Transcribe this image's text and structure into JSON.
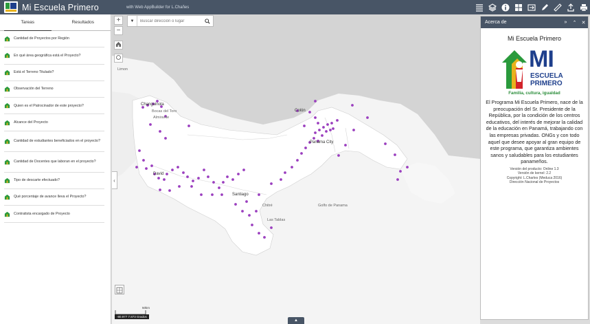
{
  "header": {
    "title": "Mi Escuela Primero",
    "subtitle": "with Web AppBuilder for L.Chañes",
    "tools": [
      "list-icon",
      "layers-icon",
      "info-icon",
      "basemap-icon",
      "swipe-icon",
      "draw-icon",
      "measure-icon",
      "share-icon",
      "print-icon"
    ]
  },
  "left_panel": {
    "tabs": [
      "Tareas",
      "Resultados"
    ],
    "tasks": [
      "Cantidad de Proyectos por Región",
      "En qué área geográfica está el Proyecto?",
      "Está el Terreno Titulado?",
      "Observación del Terreno",
      "Quien es el Patrocinador de este proyecto?",
      "Alcance del Proyecto",
      "Cantidad de estudiantes beneficiados en el proyecto?",
      "Cantidad de Docentes que laboran en el proyecto?",
      "Tipo de descarte efectuado?",
      "Qué porcentaje de avance lleva el Proyecto?",
      "Contratista encargado de Proyecto"
    ]
  },
  "map": {
    "search_placeholder": "Buscar dirección o lugar",
    "zoom_in": "+",
    "zoom_out": "−",
    "scale_label": "50km",
    "coordinates": "-80.977 7.873 Grados",
    "point_color": "#9b3fbf",
    "labels": [
      {
        "text": "Limon",
        "cls": ""
      },
      {
        "text": "Changuinola",
        "cls": "dark"
      },
      {
        "text": "Bocas del Toro",
        "cls": ""
      },
      {
        "text": "Almirante",
        "cls": ""
      },
      {
        "text": "Colón",
        "cls": "dark"
      },
      {
        "text": "Panama City",
        "cls": "dark"
      },
      {
        "text": "David",
        "cls": "dark"
      },
      {
        "text": "Santiago",
        "cls": "dark"
      },
      {
        "text": "Chitré",
        "cls": ""
      },
      {
        "text": "Las Tablas",
        "cls": ""
      },
      {
        "text": "Golfo de Panama",
        "cls": ""
      }
    ]
  },
  "about": {
    "header": "Acerca de",
    "title": "Mi Escuela Primero",
    "logo_text_mi": "MI",
    "logo_text_escuela": "ESCUELA",
    "logo_text_primero": "PRIMERO",
    "tagline": "Familia, cultura, igualdad",
    "description": "El Programa Mi Escuela Primero, nace de la preocupación del Sr. Presidente de la República, por la condición de los centros educativos, del interés de mejorar la calidad de la educación en Panamá, trabajando con las empresas privadas. ONGs y con todo aquel que desee apoyar al gran equipo de este programa, que garantiza ambientes sanos y saludables para los estudiantes panameños.",
    "version_product": "Versión del producto: Online 1.3",
    "version_kernel": "Versión de kernel: 2.2",
    "copyright": "Copyright: L.Charles (Meduca 2016)",
    "department": "Dirección Nacional de Proyectos",
    "colors": {
      "green": "#2a9a3c",
      "blue": "#1e3f8c",
      "yellow": "#e8b21d",
      "red": "#d2232a"
    }
  }
}
